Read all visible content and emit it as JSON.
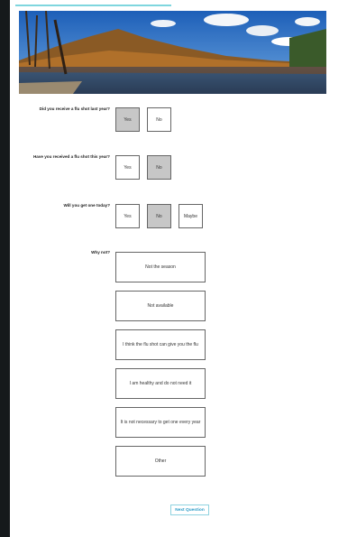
{
  "q1": {
    "label": "Did you receive a flu shot last year?",
    "yes": "Yes",
    "no": "No"
  },
  "q2": {
    "label": "Have you received a flu shot this year?",
    "yes": "Yes",
    "no": "No"
  },
  "q3": {
    "label": "Will you get one today?",
    "yes": "Yes",
    "no": "No",
    "maybe": "Maybe"
  },
  "q4": {
    "label": "Why not?",
    "options": [
      "Not the season",
      "Not available",
      "I think the flu shot can give you the flu",
      "I am healthy and do not need it",
      "It is not necessary to get one every year",
      "Other"
    ]
  },
  "next_label": "Next Question",
  "colors": {
    "selected": "#c7c7c7",
    "accent": "#2a9bc7",
    "sidebar": "#15191b"
  }
}
